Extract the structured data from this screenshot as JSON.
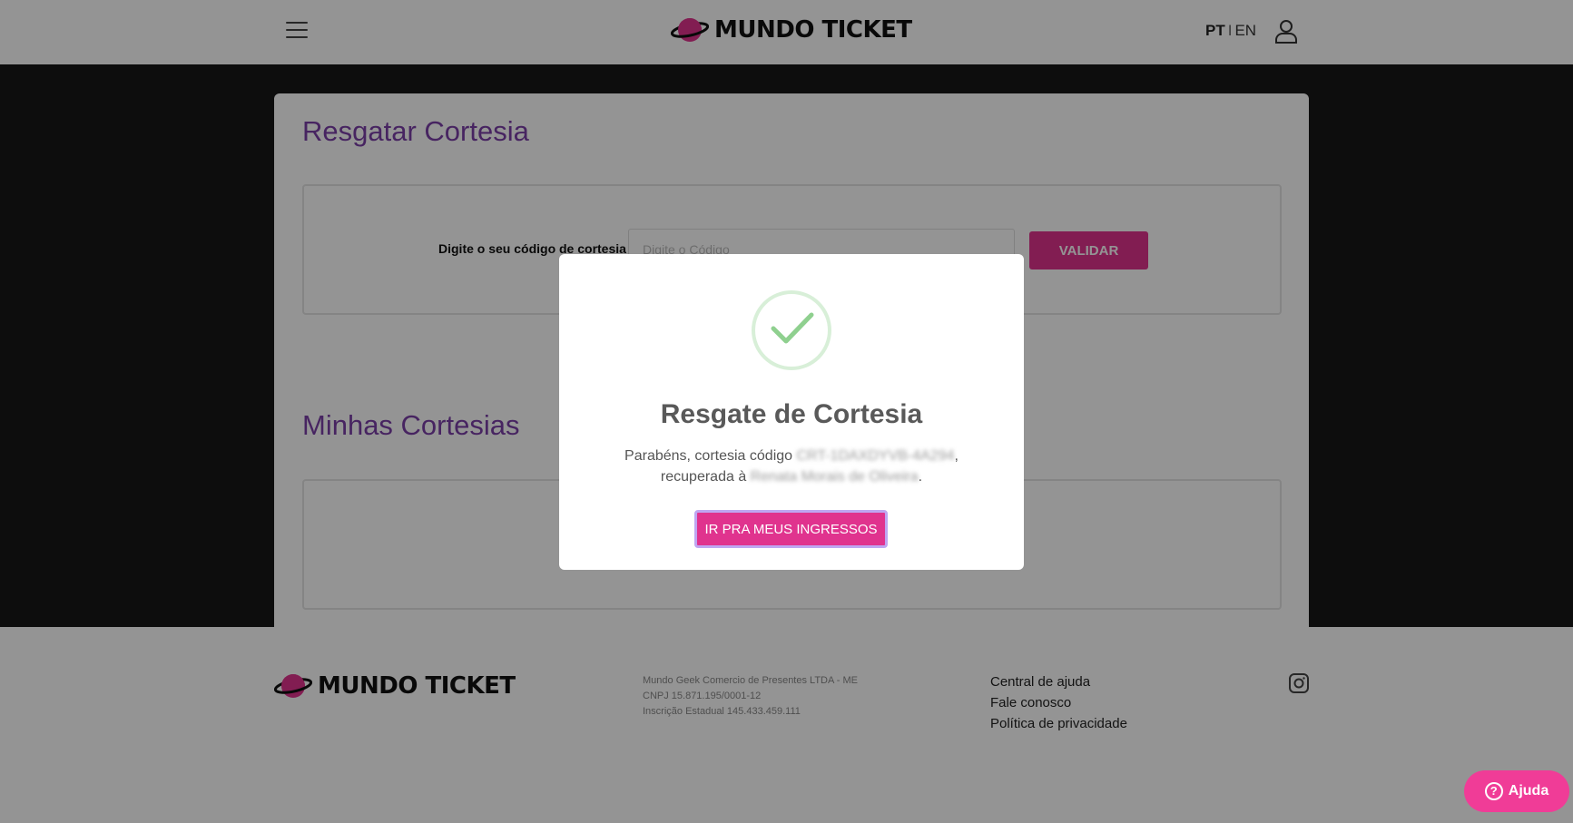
{
  "header": {
    "brand": "MUNDO TICKET",
    "lang_pt": "PT",
    "lang_sep": "I",
    "lang_en": "EN"
  },
  "redeem": {
    "title": "Resgatar Cortesia",
    "code_label": "Digite o seu código de cortesia",
    "code_placeholder": "Digite o Código",
    "validate_label": "VALIDAR"
  },
  "my_courtesies": {
    "title": "Minhas Cortesias"
  },
  "footer": {
    "brand": "MUNDO TICKET",
    "company_name": "Mundo Geek Comercio de Presentes LTDA - ME",
    "cnpj": "CNPJ 15.871.195/0001-12",
    "state_registration": "Inscrição Estadual 145.433.459.111",
    "links": [
      "Central de ajuda",
      "Fale conosco",
      "Política de privacidade"
    ]
  },
  "modal": {
    "title": "Resgate de Cortesia",
    "msg_prefix": "Parabéns, cortesia código ",
    "code_redacted": "CRT-1DAXDYVB-4A294",
    "msg_middle": "recuperada à ",
    "name_redacted": "Renata Morais de Oliveira",
    "button_label": "IR PRA MEUS INGRESSOS"
  },
  "help": {
    "label": "Ajuda"
  },
  "colors": {
    "accent_pink": "#e0338e",
    "title_purple": "#7b3fa8",
    "success_green": "#8fd08f"
  }
}
